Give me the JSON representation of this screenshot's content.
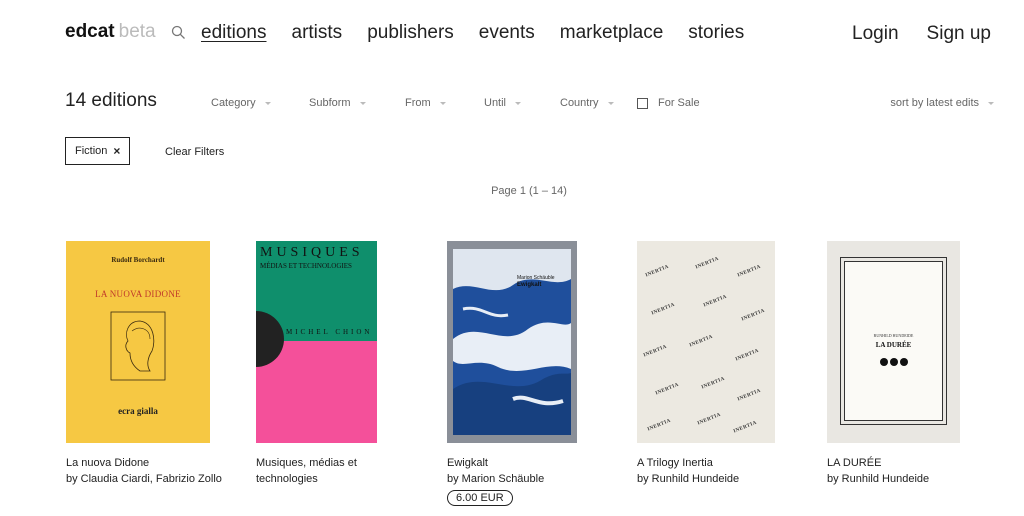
{
  "header": {
    "brand": "edcat",
    "beta": "beta",
    "nav": [
      "editions",
      "artists",
      "publishers",
      "events",
      "marketplace",
      "stories"
    ],
    "active_nav": "editions",
    "login": "Login",
    "signup": "Sign up"
  },
  "filters": {
    "count": "14 editions",
    "category": "Category",
    "subform": "Subform",
    "from": "From",
    "until": "Until",
    "country": "Country",
    "for_sale": "For Sale",
    "sort": "sort by latest edits",
    "active_chip": "Fiction",
    "chip_remove": "×",
    "clear": "Clear Filters",
    "page_info": "Page 1 (1 – 14)"
  },
  "editions": [
    {
      "title": "La nuova Didone",
      "author": "by Claudia Ciardi, Fabrizio Zollo",
      "cover": {
        "author": "Rudolf Borchardt",
        "title": "LA NUOVA DIDONE",
        "publisher": "ecra gialla"
      }
    },
    {
      "title": "Musiques, médias et technologies",
      "author": "",
      "cover": {
        "line1": "MUSIQUES",
        "line2": "MÉDIAS ET TECHNOLOGIES",
        "line3": "MICHEL CHION"
      }
    },
    {
      "title": "Ewigkalt",
      "author": "by Marion Schäuble",
      "price": "6.00 EUR",
      "cover": {
        "author": "Marion Schäuble",
        "title": "Ewigkalt"
      }
    },
    {
      "title": "A Trilogy Inertia",
      "author": "by Runhild Hundeide",
      "cover": {
        "word": "INERTIA"
      }
    },
    {
      "title": "LA DURÉE",
      "author": "by Runhild Hundeide",
      "cover": {
        "author": "RUNHILD HUNDEIDE",
        "title": "LA DURÉE"
      }
    }
  ],
  "colors": {
    "cover1": "#f6c843",
    "cover1_title": "#c0372a",
    "cover2_green": "#0f8f6c",
    "cover2_pink": "#f4509a",
    "cover3_blue": "#1f4f9c"
  }
}
